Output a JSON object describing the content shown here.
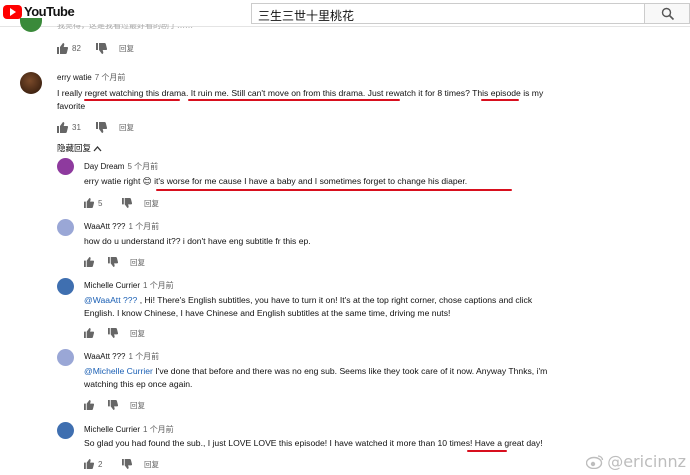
{
  "header": {
    "logo_text": "YouTube",
    "search_value": "三生三世十里桃花"
  },
  "comments": [
    {
      "id": "top-cut",
      "text": "我觉得，这是我看过最好看的剧了……",
      "likes": "82",
      "reply_label": "回复"
    },
    {
      "id": "erry-watie",
      "author": "erry watie",
      "time": "7 个月前",
      "line1": "I really regret watching this drama. It ruin me. Still can't move on from this drama. Just rewatch it for 8 times? This episode is my",
      "line2": "favorite",
      "likes": "31",
      "reply_label": "回复"
    },
    {
      "id": "day-dream",
      "author": "Day Dream",
      "time": "5 个月前",
      "line1": "erry watie right 😊 it's worse for me cause I have a baby and I sometimes forget to change his diaper.",
      "likes": "5",
      "reply_label": "回复"
    },
    {
      "id": "waaatt-1",
      "author": "WaaAtt ???",
      "time": "1 个月前",
      "line1": "how do u understand it?? i don't have eng subtitle fr this ep.",
      "likes": "",
      "reply_label": "回复"
    },
    {
      "id": "michelle-1",
      "author": "Michelle Currier",
      "time": "1 个月前",
      "mention": "@WaaAtt ???",
      "line1_rest": " ,  Hi! There's English subtitles, you have to turn it on! It's at the top right corner, chose captions and click",
      "line2": "English. I know Chinese, I have Chinese and English subtitles at the same time, driving me nuts!",
      "likes": "",
      "reply_label": "回复"
    },
    {
      "id": "waaatt-2",
      "author": "WaaAtt ???",
      "time": "1 个月前",
      "mention": "@Michelle Currier",
      "line1_rest": "  I've done that before and there was no eng sub. Seems like they took care of it now. Anyway Thnks, i'm",
      "line2": "watching this ep once again.",
      "likes": "",
      "reply_label": "回复"
    },
    {
      "id": "michelle-2",
      "author": "Michelle Currier",
      "time": "1 个月前",
      "line1": "So glad you had found the sub., I just LOVE LOVE this episode! I have watched it more than 10 times! Have a great day!",
      "likes": "2",
      "reply_label": "回复"
    }
  ],
  "hide_replies_label": "隐藏回复",
  "watermark": "@ericinnz",
  "colors": {
    "underline": "#d80f1e",
    "mention": "#1a5fb4",
    "brand": "#ff0000"
  }
}
